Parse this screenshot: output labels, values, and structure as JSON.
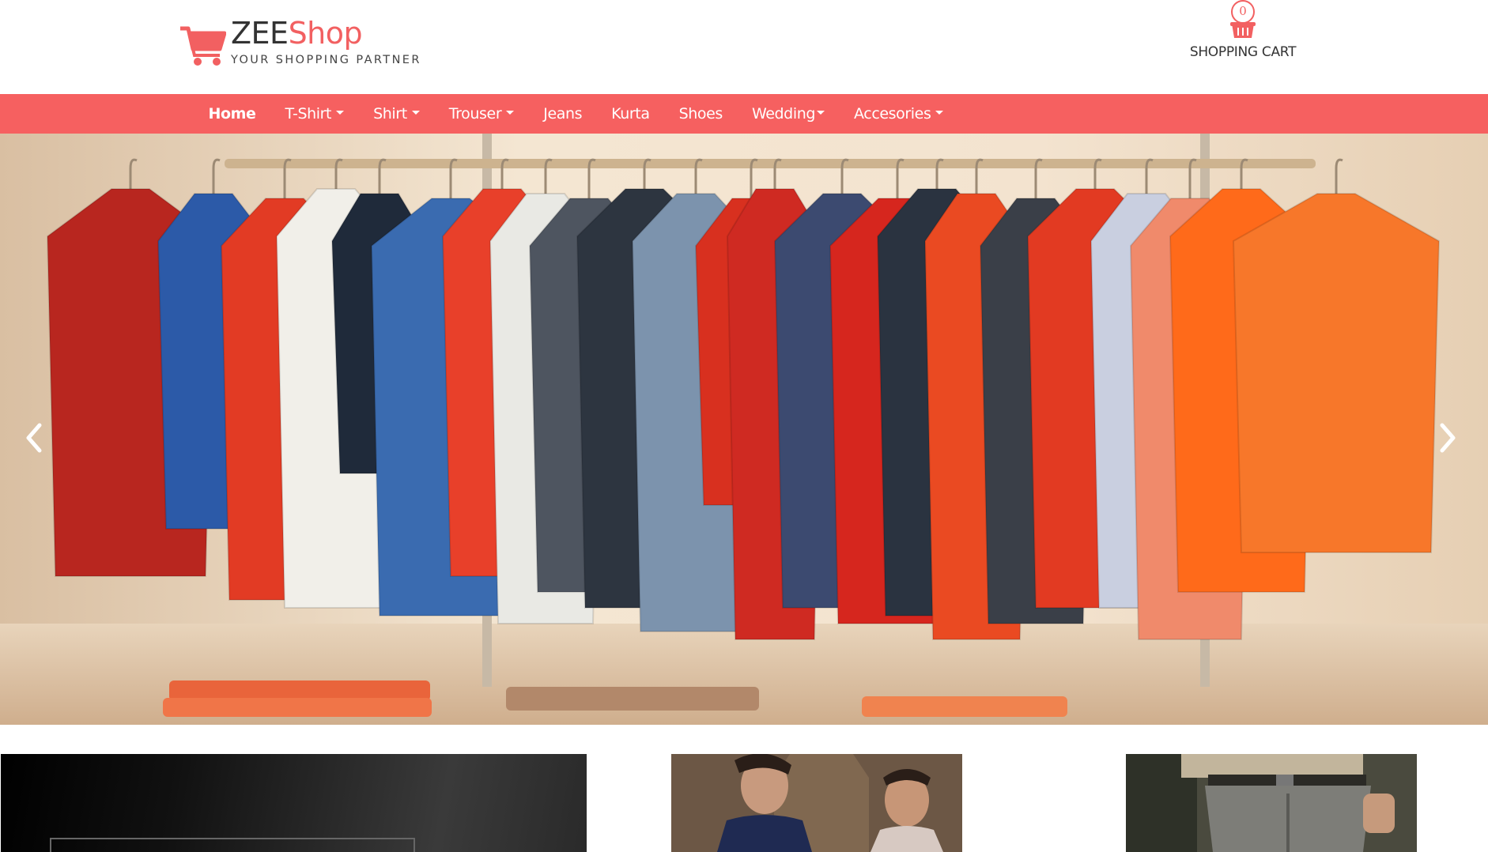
{
  "header": {
    "brand_part1": "ZEE",
    "brand_part2": "Shop",
    "tagline": "YOUR SHOPPING PARTNER",
    "cart_count": "0",
    "cart_label": "SHOPPING CART",
    "brand_color": "#f26061"
  },
  "nav": {
    "color": "#f66060",
    "items": [
      {
        "label": "Home",
        "dropdown": false,
        "active": true
      },
      {
        "label": "T-Shirt",
        "dropdown": true
      },
      {
        "label": "Shirt",
        "dropdown": true
      },
      {
        "label": "Trouser",
        "dropdown": true
      },
      {
        "label": "Jeans",
        "dropdown": false
      },
      {
        "label": "Kurta",
        "dropdown": false
      },
      {
        "label": "Shoes",
        "dropdown": false
      },
      {
        "label": "Wedding",
        "dropdown": true
      },
      {
        "label": "Accesories",
        "dropdown": true
      }
    ]
  },
  "carousel": {
    "slide_description_icon": "clothing-rack-photo",
    "prev_icon": "chevron-left-icon",
    "next_icon": "chevron-right-icon"
  },
  "promo_tiles": {
    "icons": [
      "dark-banner-image",
      "kurta-models-photo",
      "trousers-model-photo"
    ]
  }
}
